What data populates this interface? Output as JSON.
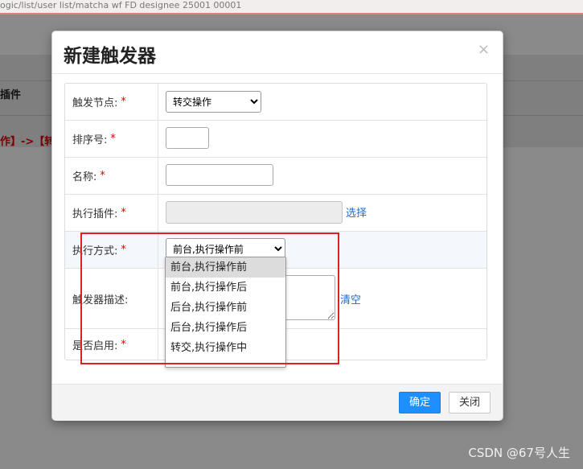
{
  "background": {
    "url_fragment": "ogic/list/user list/matcha wf FD designee 25001 00001",
    "column_header": "插件",
    "red_text": "作】->【转"
  },
  "modal": {
    "title": "新建触发器",
    "close_glyph": "×",
    "fields": {
      "trigger_node": {
        "label": "触发节点:",
        "required": "*",
        "value": "转交操作"
      },
      "sort_no": {
        "label": "排序号:",
        "required": "*",
        "value": ""
      },
      "name": {
        "label": "名称:",
        "required": "*",
        "value": ""
      },
      "plugin": {
        "label": "执行插件:",
        "required": "*",
        "value": "",
        "link": "选择"
      },
      "exec_mode": {
        "label": "执行方式:",
        "required": "*",
        "value": "前台,执行操作前",
        "options": [
          "前台,执行操作前",
          "前台,执行操作后",
          "后台,执行操作前",
          "后台,执行操作后",
          "转交,执行操作中"
        ]
      },
      "description": {
        "label": "触发器描述:",
        "link": "清空"
      },
      "enabled": {
        "label": "是否启用:",
        "required": "*"
      }
    },
    "footer": {
      "confirm": "确定",
      "close": "关闭"
    }
  },
  "watermark": "CSDN @67号人生",
  "colors": {
    "primary": "#1e8fff",
    "required": "#dd0000",
    "annotation": "#e02020"
  }
}
